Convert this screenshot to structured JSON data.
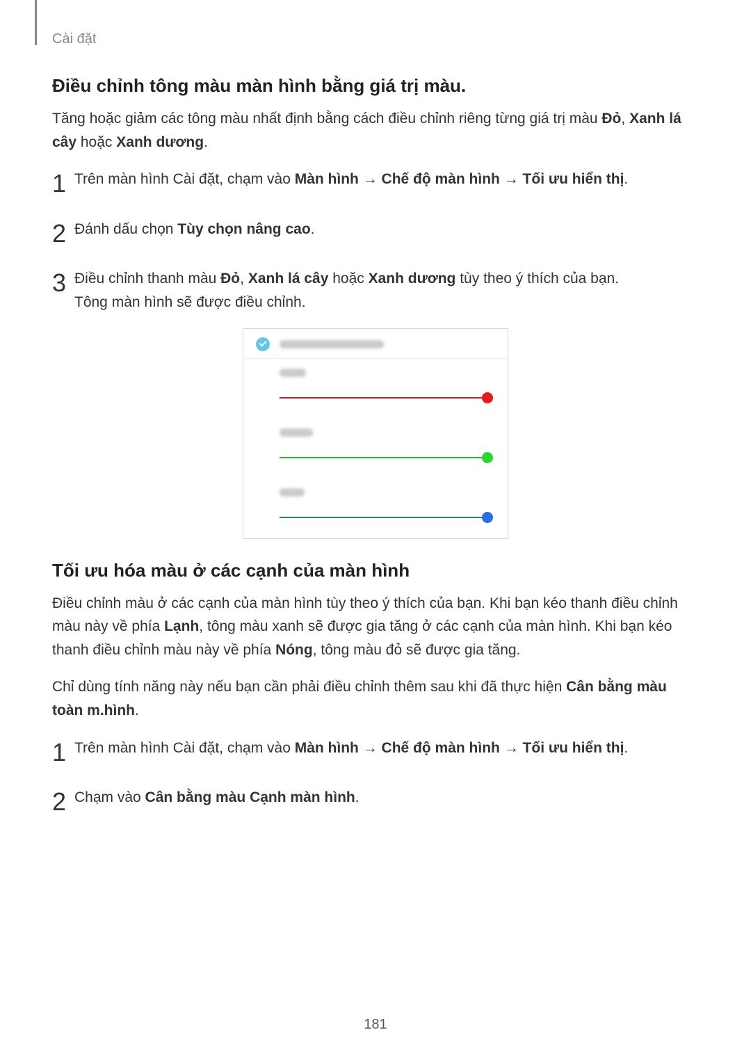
{
  "breadcrumb": "Cài đặt",
  "section1": {
    "heading": "Điều chỉnh tông màu màn hình bằng giá trị màu.",
    "intro_parts": {
      "p1": "Tăng hoặc giảm các tông màu nhất định bằng cách điều chỉnh riêng từng giá trị màu ",
      "b1": "Đỏ",
      "sep1": ", ",
      "b2": "Xanh lá cây",
      "sep2": " hoặc ",
      "b3": "Xanh dương",
      "end": "."
    },
    "steps": [
      {
        "num": "1",
        "prefix": "Trên màn hình Cài đặt, chạm vào ",
        "b1": "Màn hình",
        "arrow1": " → ",
        "b2": "Chế độ màn hình",
        "arrow2": " → ",
        "b3": "Tối ưu hiển thị",
        "suffix": "."
      },
      {
        "num": "2",
        "prefix": "Đánh dấu chọn ",
        "b1": "Tùy chọn nâng cao",
        "suffix": "."
      },
      {
        "num": "3",
        "prefix": "Điều chỉnh thanh màu ",
        "b1": "Đỏ",
        "sep1": ", ",
        "b2": "Xanh lá cây",
        "sep2": " hoặc ",
        "b3": "Xanh dương",
        "mid": " tùy theo ý thích của bạn.",
        "line2": "Tông màn hình sẽ được điều chỉnh."
      }
    ]
  },
  "figure": {
    "sliders": [
      "red",
      "green",
      "blue"
    ]
  },
  "section2": {
    "heading": "Tối ưu hóa màu ở các cạnh của màn hình",
    "p1": {
      "t1": "Điều chỉnh màu ở các cạnh của màn hình tùy theo ý thích của bạn. Khi bạn kéo thanh điều chỉnh màu này về phía ",
      "b1": "Lạnh",
      "t2": ", tông màu xanh sẽ được gia tăng ở các cạnh của màn hình. Khi bạn kéo thanh điều chỉnh màu này về phía ",
      "b2": "Nóng",
      "t3": ", tông màu đỏ sẽ được gia tăng."
    },
    "p2": {
      "t1": "Chỉ dùng tính năng này nếu bạn cần phải điều chỉnh thêm sau khi đã thực hiện ",
      "b1": "Cân bằng màu toàn m.hình",
      "t2": "."
    },
    "steps": [
      {
        "num": "1",
        "prefix": "Trên màn hình Cài đặt, chạm vào ",
        "b1": "Màn hình",
        "arrow1": " → ",
        "b2": "Chế độ màn hình",
        "arrow2": " → ",
        "b3": "Tối ưu hiển thị",
        "suffix": "."
      },
      {
        "num": "2",
        "prefix": "Chạm vào ",
        "b1": "Cân bằng màu Cạnh màn hình",
        "suffix": "."
      }
    ]
  },
  "page_number": "181"
}
